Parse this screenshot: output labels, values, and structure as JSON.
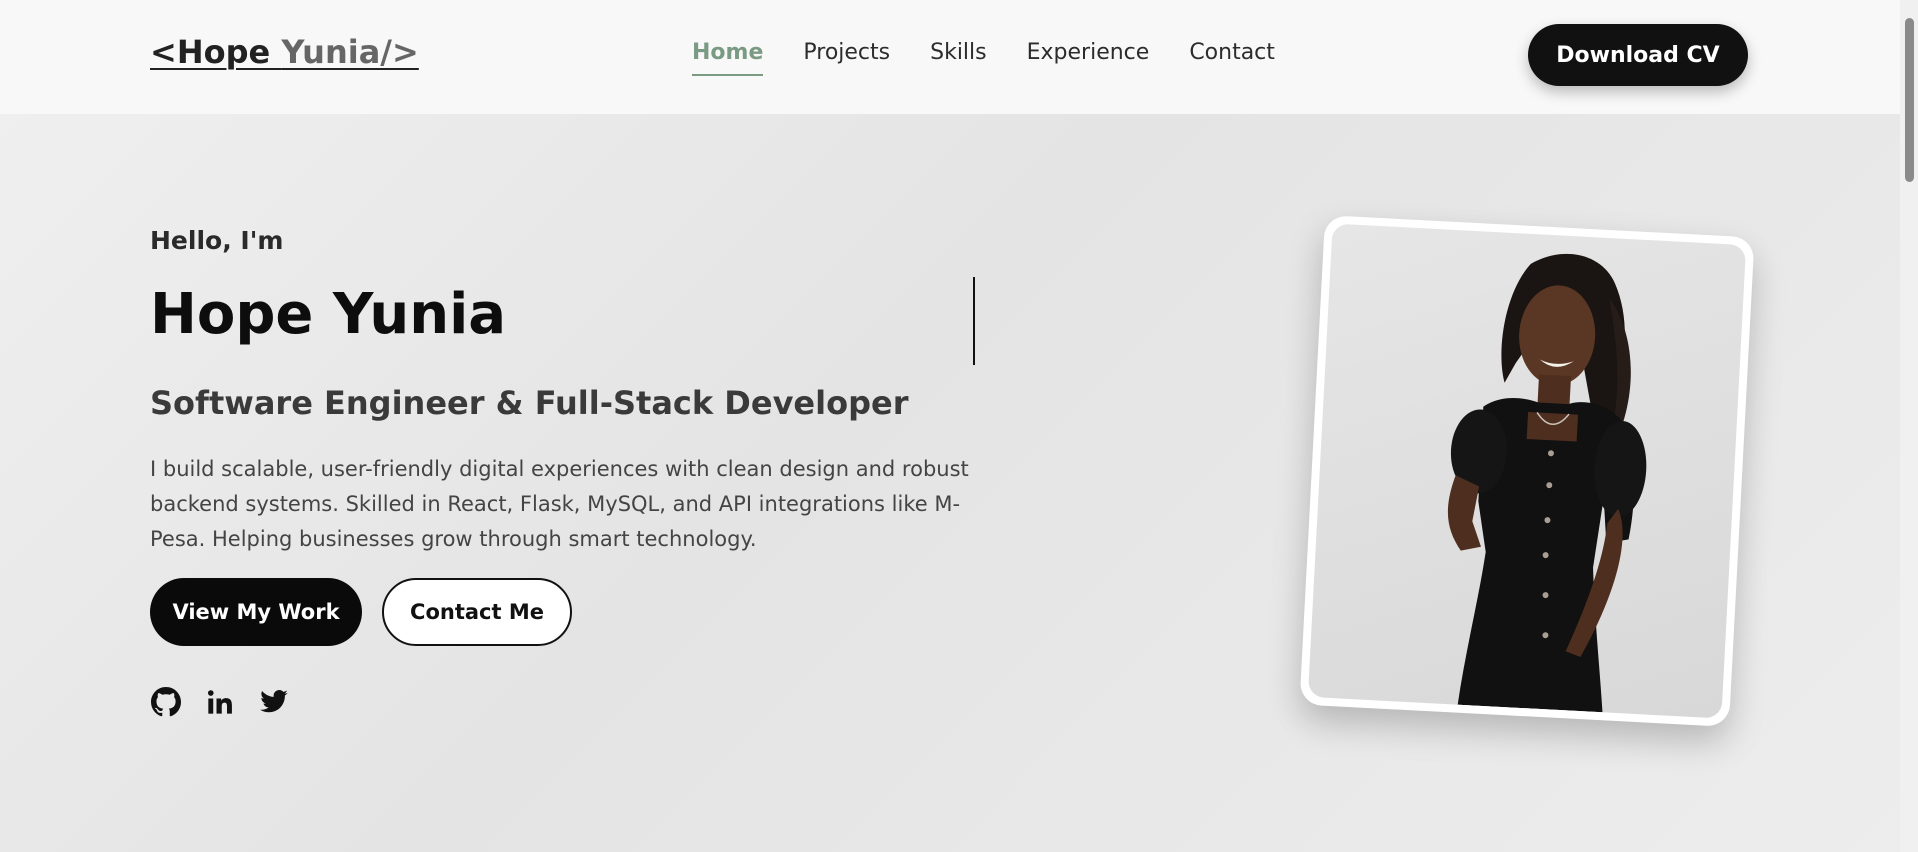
{
  "nav": {
    "logo_main": "<Hope ",
    "logo_accent": "Yunia/>",
    "links": [
      {
        "label": "Home",
        "active": true
      },
      {
        "label": "Projects"
      },
      {
        "label": "Skills"
      },
      {
        "label": "Experience"
      },
      {
        "label": "Contact"
      }
    ],
    "cv_button": "Download CV"
  },
  "hero": {
    "greeting": "Hello, I'm",
    "name": "Hope Yunia",
    "role": "Software Engineer & Full-Stack Developer",
    "bio": "I build scalable, user-friendly digital experiences with clean design and robust backend systems. Skilled in React, Flask, MySQL, and API integrations like M-Pesa. Helping businesses grow through smart technology.",
    "primary_button": "View My Work",
    "secondary_button": "Contact Me",
    "socials": [
      "github-icon",
      "linkedin-icon",
      "twitter-icon"
    ]
  },
  "colors": {
    "accent": "#7b9a84",
    "dark": "#111111"
  }
}
